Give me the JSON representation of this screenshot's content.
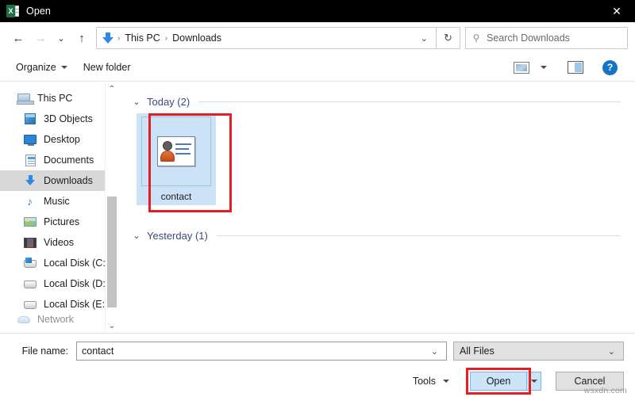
{
  "window": {
    "title": "Open",
    "app_icon": "excel-icon",
    "close_label": "✕"
  },
  "nav": {
    "back": "←",
    "forward": "→",
    "recent": "⌄",
    "up": "↑",
    "refresh": "↻",
    "address_chevron": "⌄",
    "breadcrumbs": [
      {
        "label": "This PC"
      },
      {
        "label": "Downloads"
      }
    ],
    "separator": "›",
    "location_icon": "downloads-arrow-icon"
  },
  "search": {
    "placeholder": "Search Downloads",
    "icon": "search-icon"
  },
  "toolbar": {
    "organize_label": "Organize",
    "new_folder_label": "New folder",
    "view_icon": "view-layout-icon",
    "view_dropdown_icon": "chevron-down-icon",
    "preview_pane_icon": "preview-pane-icon",
    "help_icon": "help-icon",
    "help_glyph": "?"
  },
  "sidebar": {
    "items": [
      {
        "label": "This PC",
        "icon": "this-pc-icon",
        "selected": false,
        "indent": false
      },
      {
        "label": "3D Objects",
        "icon": "3d-objects-icon",
        "selected": false,
        "indent": true
      },
      {
        "label": "Desktop",
        "icon": "desktop-icon",
        "selected": false,
        "indent": true
      },
      {
        "label": "Documents",
        "icon": "documents-icon",
        "selected": false,
        "indent": true
      },
      {
        "label": "Downloads",
        "icon": "downloads-icon",
        "selected": true,
        "indent": true
      },
      {
        "label": "Music",
        "icon": "music-icon",
        "selected": false,
        "indent": true
      },
      {
        "label": "Pictures",
        "icon": "pictures-icon",
        "selected": false,
        "indent": true
      },
      {
        "label": "Videos",
        "icon": "videos-icon",
        "selected": false,
        "indent": true
      },
      {
        "label": "Local Disk (C:)",
        "icon": "system-drive-icon",
        "selected": false,
        "indent": true
      },
      {
        "label": "Local Disk (D:)",
        "icon": "drive-icon",
        "selected": false,
        "indent": true
      },
      {
        "label": "Local Disk (E:)",
        "icon": "drive-icon",
        "selected": false,
        "indent": true
      },
      {
        "label": "Network",
        "icon": "network-icon",
        "selected": false,
        "indent": false
      }
    ],
    "scroll_up_icon": "chevron-up-icon",
    "scroll_down_icon": "chevron-down-icon"
  },
  "content": {
    "groups": [
      {
        "title": "Today (2)",
        "chevron": "⌄",
        "files": [
          {
            "name": "contact",
            "icon": "contact-card-icon",
            "selected": true,
            "highlighted": true
          }
        ]
      },
      {
        "title": "Yesterday (1)",
        "chevron": "⌄",
        "files": []
      }
    ]
  },
  "footer": {
    "file_name_label": "File name:",
    "file_name_value": "contact",
    "file_name_chevron": "⌄",
    "file_type_value": "All Files",
    "file_type_chevron": "⌄",
    "tools_label": "Tools",
    "open_label": "Open",
    "open_split_icon": "caret-down-icon",
    "cancel_label": "Cancel",
    "open_highlighted": true
  },
  "watermark": "wsxdn.com",
  "colors": {
    "titlebar_bg": "#000000",
    "selection_blue": "#cce3f7",
    "highlight_red": "#e31e24",
    "accent_blue": "#2e8ae6",
    "group_header_text": "#3b4a78",
    "sidebar_selected_bg": "#d8d8d8"
  }
}
